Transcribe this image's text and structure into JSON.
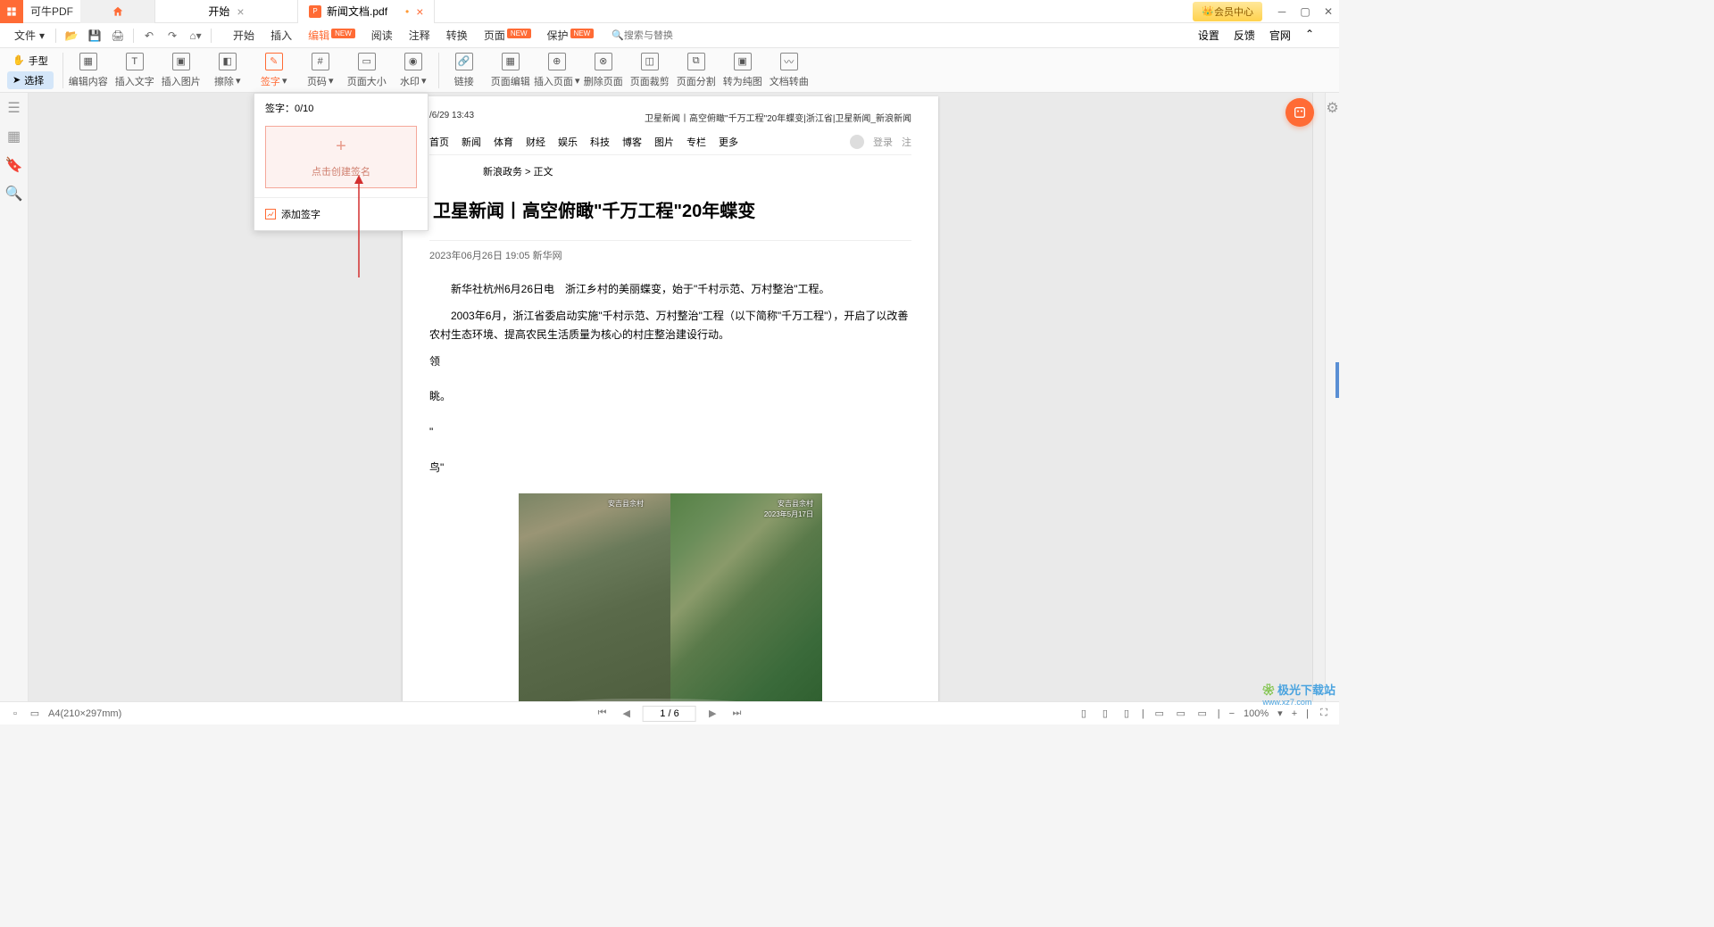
{
  "app": {
    "name": "可牛PDF"
  },
  "tabs": {
    "start": "开始",
    "doc": "新闻文档.pdf"
  },
  "titlebar": {
    "vip": "会员中心"
  },
  "menubar": {
    "file": "文件",
    "tabs": {
      "start": "开始",
      "insert": "插入",
      "edit": "编辑",
      "read": "阅读",
      "annotate": "注释",
      "convert": "转换",
      "page": "页面",
      "protect": "保护"
    },
    "new_badge": "NEW",
    "search_placeholder": "搜索与替换",
    "right": {
      "settings": "设置",
      "feedback": "反馈",
      "official": "官网"
    }
  },
  "toolbar": {
    "hand": "手型",
    "select": "选择",
    "items": [
      "编辑内容",
      "插入文字",
      "插入图片",
      "擦除",
      "签字",
      "页码",
      "页面大小",
      "水印",
      "链接",
      "页面编辑",
      "插入页面",
      "删除页面",
      "页面裁剪",
      "页面分割",
      "转为纯图",
      "文档转曲"
    ]
  },
  "popup": {
    "header_label": "签字：",
    "count": "0/10",
    "create": "点击创建签名",
    "add_handwrite": "添加签字"
  },
  "document": {
    "timestamp": "/6/29 13:43",
    "header_title": "卫星新闻丨高空俯瞰\"千万工程\"20年蝶变|浙江省|卫星新闻_新浪新闻",
    "nav": [
      "首页",
      "新闻",
      "体育",
      "财经",
      "娱乐",
      "科技",
      "博客",
      "图片",
      "专栏",
      "更多"
    ],
    "nav_login": "登录",
    "nav_register": "注",
    "breadcrumb": "新浪政务 > 正文",
    "title": "卫星新闻丨高空俯瞰\"千万工程\"20年蝶变",
    "meta": "2023年06月26日 19:05   新华网",
    "para1": "新华社杭州6月26日电　浙江乡村的美丽蝶变，始于\"千村示范、万村整治\"工程。",
    "para2": "2003年6月，浙江省委启动实施\"千村示范、万村整治\"工程（以下简称\"千万工程\"），开启了以改善农村生态环境、提高农民生活质量为核心的村庄整治建设行动。",
    "frag1": "领",
    "frag2": "眺。",
    "frag3": "\"",
    "frag4": "鸟\"",
    "sat_left": "安吉县余村",
    "sat_right_1": "安吉县余村",
    "sat_right_2": "2023年5月17日"
  },
  "statusbar": {
    "paper": "A4(210×297mm)",
    "page": "1 / 6",
    "zoom": "100%"
  },
  "watermark": {
    "brand": "极光下载站",
    "url": "www.xz7.com"
  }
}
